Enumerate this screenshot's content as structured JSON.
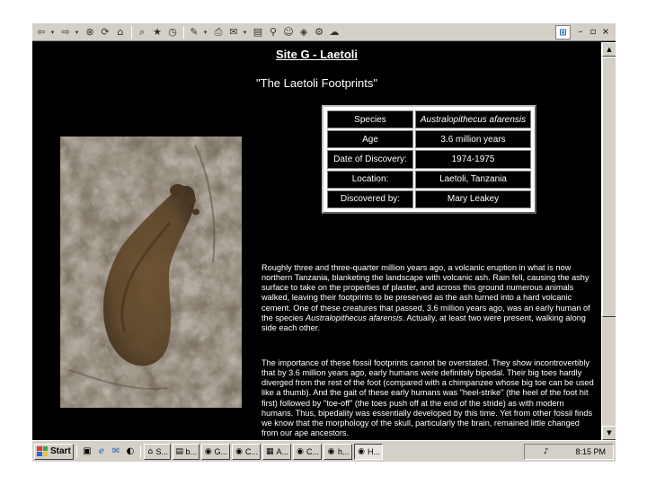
{
  "toolbar": {
    "icons": [
      "back-icon",
      "forward-icon",
      "stop-icon",
      "refresh-icon",
      "home-icon",
      "search-icon",
      "favorites-icon",
      "history-icon",
      "mail-icon",
      "print-icon",
      "edit-icon",
      "discuss-icon",
      "messenger-icon"
    ],
    "window_controls": {
      "minimize": "–",
      "restore": "▫",
      "close": "×"
    }
  },
  "page": {
    "heading": "Site G - Laetoli",
    "subheading": "\"The Laetoli Footprints\""
  },
  "facts": [
    {
      "label": "Species",
      "value": "Australopithecus afarensis",
      "italic": true
    },
    {
      "label": "Age",
      "value": "3.6 million years",
      "italic": false
    },
    {
      "label": "Date of Discovery:",
      "value": "1974-1975",
      "italic": false
    },
    {
      "label": "Location:",
      "value": "Laetoli, Tanzania",
      "italic": false
    },
    {
      "label": "Discovered by:",
      "value": "Mary Leakey",
      "italic": false
    }
  ],
  "para1": {
    "a": "Roughly three and three-quarter million years ago, a volcanic eruption in what is now northern Tanzania, blanketing the landscape with volcanic ash. Rain fell, causing the ashy surface to take on the properties of plaster, and across this ground numerous animals walked, leaving their footprints to be preserved as the ash turned into a hard volcanic cement. One of these creatures that passed, 3.6 million years ago, was an early human of the species ",
    "species": "Australopithecus afarensis",
    "b": ". Actually, at least two were present, walking along side each other."
  },
  "para2": "The importance of these fossil footprints cannot be overstated. They show incontrovertibly that by 3.6 million years ago, early humans were definitely bipedal. Their big toes hardly diverged from the rest of the foot (compared with a chimpanzee whose big toe can be used like a thumb). And the gait of these early humans was \"heel-strike\" (the heel of the foot hit first) followed by \"toe-off\" (the toes push off at the end of the stride) as with modern humans. Thus, bipedality was essentially developed by this time. Yet from other fossil finds we know that the morphology of the skull, particularly the brain, remained little changed from our ape ancestors.",
  "taskbar": {
    "start_label": "Start",
    "tasks": [
      {
        "icon": "⌂",
        "label": "S..."
      },
      {
        "icon": "▤",
        "label": "b..."
      },
      {
        "icon": "◉",
        "label": "G..."
      },
      {
        "icon": "◉",
        "label": "C..."
      },
      {
        "icon": "▦",
        "label": "A..."
      },
      {
        "icon": "◉",
        "label": "C..."
      },
      {
        "icon": "◉",
        "label": "h..."
      },
      {
        "icon": "◉",
        "label": "H..."
      }
    ],
    "clock": "8:15 PM"
  },
  "colors": {
    "background": "#000000",
    "chrome": "#d4d0c8",
    "text": "#ffffff"
  }
}
